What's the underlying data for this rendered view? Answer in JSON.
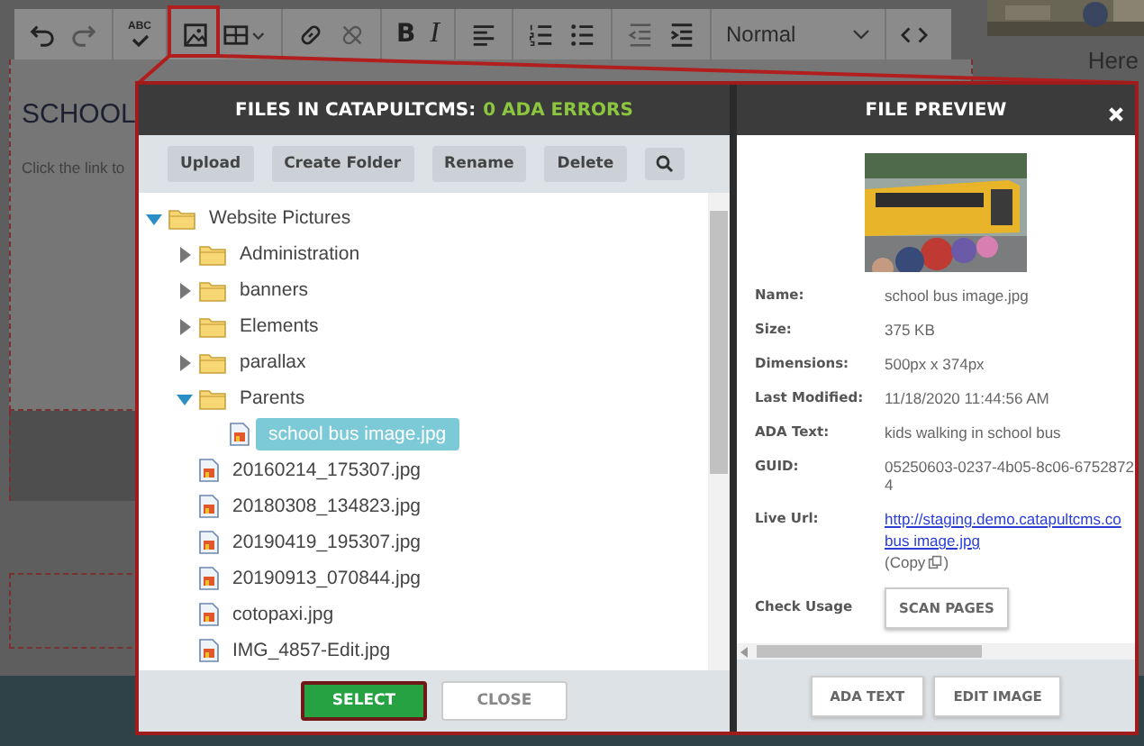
{
  "editor": {
    "toolbar": {
      "spellcheck_label": "ABC",
      "bold_label": "B",
      "italic_label": "I",
      "format": "Normal"
    },
    "page": {
      "heading": "SCHOOL",
      "text": "Click the link to",
      "side_text": "Here"
    }
  },
  "file_browser": {
    "title": "FILES IN CATAPULTCMS:",
    "error_count": "0 ADA ERRORS",
    "actions": [
      "Upload",
      "Create Folder",
      "Rename",
      "Delete"
    ],
    "tree": [
      {
        "kind": "folder",
        "label": "Website Pictures",
        "expanded": true,
        "selected": false,
        "children": [
          {
            "kind": "folder",
            "label": "Administration",
            "expanded": false,
            "selected": false
          },
          {
            "kind": "folder",
            "label": "banners",
            "expanded": false,
            "selected": false
          },
          {
            "kind": "folder",
            "label": "Elements",
            "expanded": false,
            "selected": false
          },
          {
            "kind": "folder",
            "label": "parallax",
            "expanded": false,
            "selected": false
          },
          {
            "kind": "folder",
            "label": "Parents",
            "expanded": true,
            "selected": false,
            "children": [
              {
                "kind": "file",
                "label": "school bus image.jpg",
                "selected": true
              }
            ]
          },
          {
            "kind": "file",
            "label": "20160214_175307.jpg",
            "selected": false
          },
          {
            "kind": "file",
            "label": "20180308_134823.jpg",
            "selected": false
          },
          {
            "kind": "file",
            "label": "20190419_195307.jpg",
            "selected": false
          },
          {
            "kind": "file",
            "label": "20190913_070844.jpg",
            "selected": false
          },
          {
            "kind": "file",
            "label": "cotopaxi.jpg",
            "selected": false
          },
          {
            "kind": "file",
            "label": "IMG_4857-Edit.jpg",
            "selected": false
          }
        ]
      }
    ],
    "buttons": [
      {
        "label": "SELECT",
        "kind": "primary"
      },
      {
        "label": "CLOSE",
        "kind": "secondary"
      }
    ]
  },
  "file_preview": {
    "title": "FILE PREVIEW",
    "details": [
      {
        "label": "Name:",
        "value": "school bus image.jpg"
      },
      {
        "label": "Size:",
        "value": "375 KB"
      },
      {
        "label": "Dimensions:",
        "value": "500px x 374px"
      },
      {
        "label": "Last Modified:",
        "value": "11/18/2020 11:44:56 AM"
      },
      {
        "label": "ADA Text:",
        "value": "kids walking in school bus"
      },
      {
        "label": "GUID:",
        "value": "05250603-0237-4b05-8c06-67528724"
      }
    ],
    "live_url": {
      "label": "Live Url:",
      "lines": [
        "http://staging.demo.catapultcms.co",
        "bus image.jpg"
      ],
      "copy_open": "(Copy",
      "copy_close": ")"
    },
    "check_usage": {
      "label": "Check Usage",
      "button": "SCAN PAGES"
    },
    "buttons": [
      "ADA TEXT",
      "EDIT IMAGE"
    ]
  }
}
